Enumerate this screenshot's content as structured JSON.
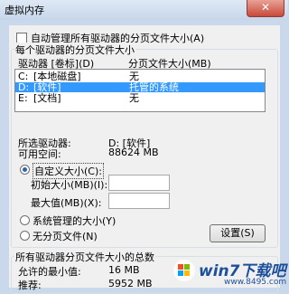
{
  "window": {
    "title": "虚拟内存",
    "close_glyph": "✕"
  },
  "auto_manage": {
    "label": "自动管理所有驱动器的分页文件大小(A)",
    "checked": false
  },
  "drives_group": {
    "title": "每个驱动器的分页文件大小",
    "col_drive": "驱动器 [卷标](D)",
    "col_size": "分页文件大小(MB)",
    "rows": [
      {
        "drive": "C:",
        "label": "[本地磁盘]",
        "size": "无"
      },
      {
        "drive": "D:",
        "label": "[软件]",
        "size": "托管的系统"
      },
      {
        "drive": "E:",
        "label": "[文档]",
        "size": "无"
      }
    ],
    "selected_index": 1
  },
  "selected_drive": {
    "label": "所选驱动器:",
    "value": "D: [软件]"
  },
  "free_space": {
    "label": "可用空间:",
    "value": "88624 MB"
  },
  "custom_size": {
    "label": "自定义大小(C):",
    "selected": true
  },
  "initial_size": {
    "label": "初始大小(MB)(I):",
    "value": ""
  },
  "max_size": {
    "label": "最大值(MB)(X):",
    "value": ""
  },
  "system_managed": {
    "label": "系统管理的大小(Y)",
    "selected": false
  },
  "no_paging": {
    "label": "无分页文件(N)",
    "selected": false
  },
  "set_button": {
    "label": "设置(S)"
  },
  "totals_group": {
    "title": "所有驱动器分页文件大小的总数",
    "min_allowed": {
      "label": "允许的最小值:",
      "value": "16 MB"
    },
    "recommended": {
      "label": "推荐:",
      "value": "5952 MB"
    }
  },
  "watermark": {
    "brand": "win7下载吧",
    "url": "www.8495.com"
  }
}
